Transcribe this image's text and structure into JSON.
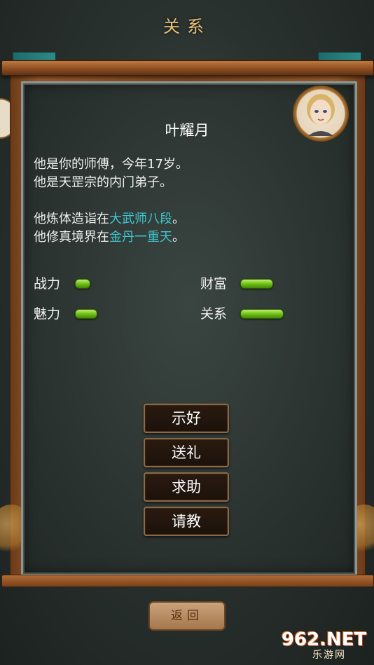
{
  "screen": {
    "title": "关系"
  },
  "character": {
    "name": "叶耀月",
    "line1": "他是你的师傅，今年17岁。",
    "line2": "他是天罡宗的内门弟子。",
    "line3_prefix": "他炼体造诣在",
    "line3_highlight": "大武师八段",
    "line3_suffix": "。",
    "line4_prefix": "他修真境界在",
    "line4_highlight": "金丹一重天",
    "line4_suffix": "。"
  },
  "stats": [
    {
      "label": "战力",
      "level": 0.2
    },
    {
      "label": "财富",
      "level": 0.45
    },
    {
      "label": "魅力",
      "level": 0.3
    },
    {
      "label": "关系",
      "level": 0.6
    }
  ],
  "actions": [
    "示好",
    "送礼",
    "求助",
    "请教"
  ],
  "back_button": "返回",
  "watermark": {
    "main": "962.NET",
    "sub": "乐游网"
  },
  "colors": {
    "highlight": "#3fc6d0",
    "bar_green": "#6cbb14",
    "title_gold": "#e8c27a"
  }
}
